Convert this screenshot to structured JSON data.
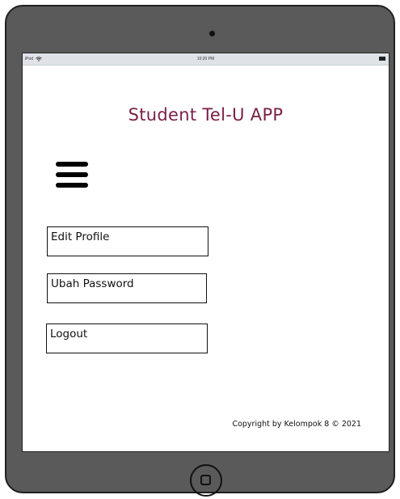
{
  "device": {
    "status_bar": {
      "carrier": "iPod",
      "time": "10:20 PM",
      "wifi_icon": "wifi-icon",
      "battery_icon": "battery-icon"
    },
    "home_button_icon": "home-button-icon"
  },
  "app": {
    "title": "Student Tel-U APP",
    "title_color": "#7b1e47",
    "menu_icon": "hamburger-menu-icon",
    "menu": {
      "edit_profile": "Edit Profile",
      "change_password": "Ubah Password",
      "logout": "Logout"
    },
    "footer": {
      "copyright": "Copyright by Kelompok 8 © 2021"
    }
  }
}
